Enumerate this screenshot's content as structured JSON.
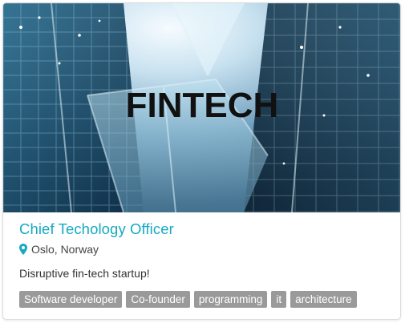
{
  "job": {
    "image_text": "FINTECH",
    "title": "Chief Techology Officer",
    "location": "Oslo, Norway",
    "description": "Disruptive fin-tech startup!",
    "tags": [
      "Software developer",
      "Co-founder",
      "programming",
      "it",
      "architecture"
    ]
  },
  "colors": {
    "title": "#16a9c2",
    "tag_background": "#9a9a9a",
    "tag_text": "#ffffff"
  },
  "icons": {
    "location": "map-pin-icon"
  }
}
